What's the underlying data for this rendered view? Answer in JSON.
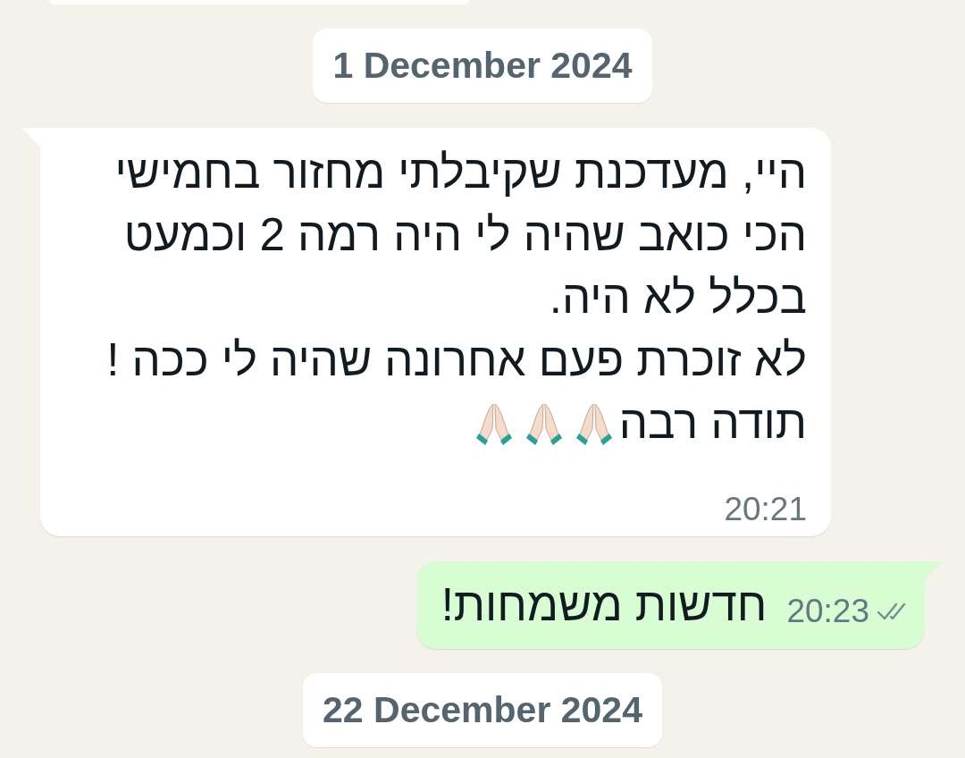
{
  "messages": [
    {
      "kind": "cut_bubble",
      "outgoing": false
    },
    {
      "kind": "date",
      "text": "1 December 2024"
    },
    {
      "kind": "message",
      "outgoing": false,
      "lines": [
        "היי, מעדכנת שקיבלתי מחזור בחמישי",
        "הכי כואב שהיה לי היה רמה 2 וכמעט",
        "בכלל לא היה.",
        "לא זוכרת פעם אחרונה שהיה לי ככה !",
        "תודה רבה"
      ],
      "trailing_icons": [
        {
          "kind": "praying_hands"
        },
        {
          "kind": "praying_hands"
        },
        {
          "kind": "praying_hands"
        }
      ],
      "time": "20:21"
    },
    {
      "kind": "message",
      "outgoing": true,
      "lines": [
        "חדשות משמחות!"
      ],
      "time": "20:23",
      "read": false
    },
    {
      "kind": "date",
      "text": "22 December 2024"
    }
  ]
}
